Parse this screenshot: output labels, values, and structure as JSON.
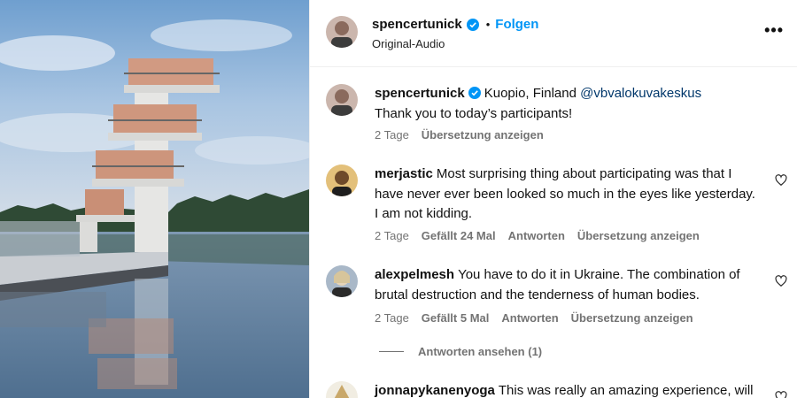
{
  "post_header": {
    "username": "spencertunick",
    "separator": "•",
    "follow_label": "Folgen",
    "audio_label": "Original-Audio",
    "more_icon": "more-horizontal-icon"
  },
  "caption": {
    "username": "spencertunick",
    "location": "Kuopio, Finland",
    "mention": "@vbvalokuvakeskus",
    "text": "Thank you to today’s participants!",
    "time": "2 Tage",
    "translate": "Übersetzung anzeigen"
  },
  "comments": [
    {
      "username": "merjastic",
      "text": "Most surprising thing about participating was that I have never ever been looked so much in the eyes like yesterday. I am not kidding.",
      "time": "2 Tage",
      "likes": "Gefällt 24 Mal",
      "reply": "Antworten",
      "translate": "Übersetzung anzeigen"
    },
    {
      "username": "alexpelmesh",
      "text": "You have to do it in Ukraine. The combination of brutal destruction and the tenderness of human bodies.",
      "time": "2 Tage",
      "likes": "Gefällt 5 Mal",
      "reply": "Antworten",
      "translate": "Übersetzung anzeigen",
      "view_replies": "Antworten ansehen (1)"
    },
    {
      "username": "jonnapykanenyoga",
      "text": "This was really an amazing experience, will"
    }
  ],
  "colors": {
    "accent": "#0095f6",
    "muted": "#737373",
    "verified": "#0095f6"
  }
}
